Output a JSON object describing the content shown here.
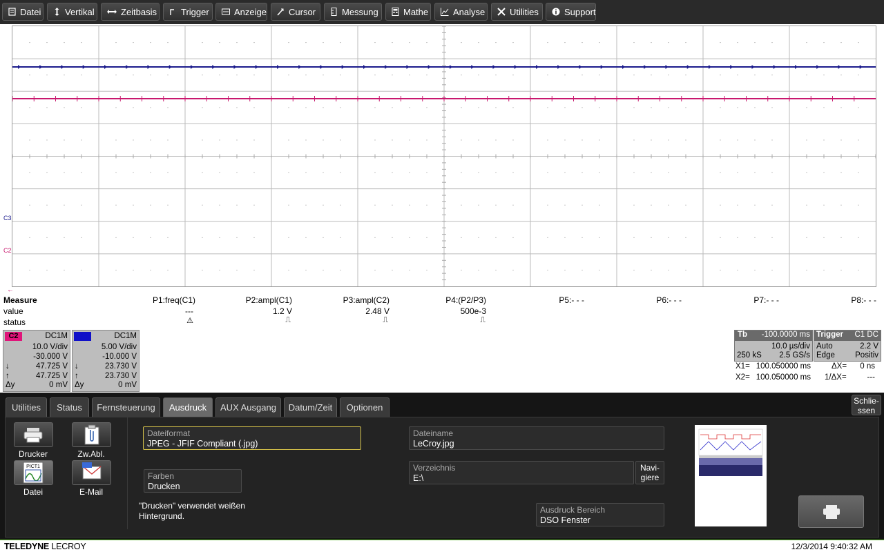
{
  "menu": {
    "items": [
      {
        "label": "Datei",
        "icon": "document-icon"
      },
      {
        "label": "Vertikal",
        "icon": "vertical-arrows-icon"
      },
      {
        "label": "Zeitbasis",
        "icon": "horizontal-arrows-icon"
      },
      {
        "label": "Trigger",
        "icon": "trigger-edge-icon"
      },
      {
        "label": "Anzeige",
        "icon": "display-icon"
      },
      {
        "label": "Cursor",
        "icon": "cursor-icon"
      },
      {
        "label": "Messung",
        "icon": "ruler-icon"
      },
      {
        "label": "Mathe",
        "icon": "calculator-icon"
      },
      {
        "label": "Analyse",
        "icon": "chart-icon"
      },
      {
        "label": "Utilities",
        "icon": "tools-icon"
      },
      {
        "label": "Support",
        "icon": "info-icon"
      }
    ]
  },
  "traces": {
    "c3_label": "C3",
    "c2_label": "C2",
    "c3_color": "#1a1a8c",
    "c2_color": "#c8186e"
  },
  "measure": {
    "row_labels": [
      "Measure",
      "value",
      "status"
    ],
    "params": [
      {
        "name": "P1:freq(C1)",
        "value": "---",
        "status": "⚠"
      },
      {
        "name": "P2:ampl(C1)",
        "value": "1.2 V",
        "status": "⎍"
      },
      {
        "name": "P3:ampl(C2)",
        "value": "2.48 V",
        "status": "⎍"
      },
      {
        "name": "P4:(P2/P3)",
        "value": "500e-3",
        "status": "⎍"
      },
      {
        "name": "P5:- - -",
        "value": "",
        "status": ""
      },
      {
        "name": "P6:- - -",
        "value": "",
        "status": ""
      },
      {
        "name": "P7:- - -",
        "value": "",
        "status": ""
      },
      {
        "name": "P8:- - -",
        "value": "",
        "status": ""
      }
    ]
  },
  "channels": [
    {
      "tag": "C2",
      "color": "#e0157a",
      "coupling": "DC1M",
      "vdiv": "10.0 V/div",
      "offset": "-30.000 V",
      "down": "47.725 V",
      "up": "47.725 V",
      "dy_label": "Δy",
      "dy": "0 mV"
    },
    {
      "tag": "C3",
      "color": "#1010c8",
      "coupling": "DC1M",
      "vdiv": "5.00 V/div",
      "offset": "-10.000 V",
      "down": "23.730 V",
      "up": "23.730 V",
      "dy_label": "Δy",
      "dy": "0 mV"
    }
  ],
  "timebase": {
    "label": "Tb",
    "delay": "-100.0000 ms",
    "tdiv": "10.0 µs/div",
    "samples": "250 kS",
    "rate": "2.5 GS/s"
  },
  "trigger": {
    "label": "Trigger",
    "source": "C1 DC",
    "mode": "Auto",
    "level": "2.2 V",
    "type": "Edge",
    "slope": "Positiv"
  },
  "cursors": {
    "x1_label": "X1=",
    "x1": "100.050000 ms",
    "dx_label": "ΔX=",
    "dx": "0 ns",
    "x2_label": "X2=",
    "x2": "100.050000 ms",
    "inv_dx_label": "1/ΔX=",
    "inv_dx": "---"
  },
  "dialog": {
    "tabs": [
      "Utilities",
      "Status",
      "Fernsteuerung",
      "Ausdruck",
      "AUX Ausgang",
      "Datum/Zeit",
      "Optionen"
    ],
    "active_tab": "Ausdruck",
    "close_label_1": "Schlie-",
    "close_label_2": "ssen",
    "buttons": [
      {
        "label": "Drucker",
        "icon": "printer-icon"
      },
      {
        "label": "Zw.Abl.",
        "icon": "clipboard-icon"
      },
      {
        "label": "Datei",
        "icon": "file-image-icon",
        "icon_text": "PICT1"
      },
      {
        "label": "E-Mail",
        "icon": "email-icon"
      }
    ],
    "dateiformat_caption": "Dateiformat",
    "dateiformat_value": "JPEG - JFIF Compliant (.jpg)",
    "farben_caption": "Farben",
    "farben_value": "Drucken",
    "note_line1": "\"Drucken\" verwendet weißen",
    "note_line2": "Hintergrund.",
    "dateiname_caption": "Dateiname",
    "dateiname_value": "LeCroy.jpg",
    "verzeichnis_caption": "Verzeichnis",
    "verzeichnis_value": "E:\\",
    "navigiere_1": "Navi-",
    "navigiere_2": "giere",
    "bereich_caption": "Ausdruck Bereich",
    "bereich_value": "DSO Fenster"
  },
  "footer": {
    "brand_bold": "TELEDYNE",
    "brand": "LECROY",
    "datetime": "12/3/2014 9:40:32 AM"
  }
}
